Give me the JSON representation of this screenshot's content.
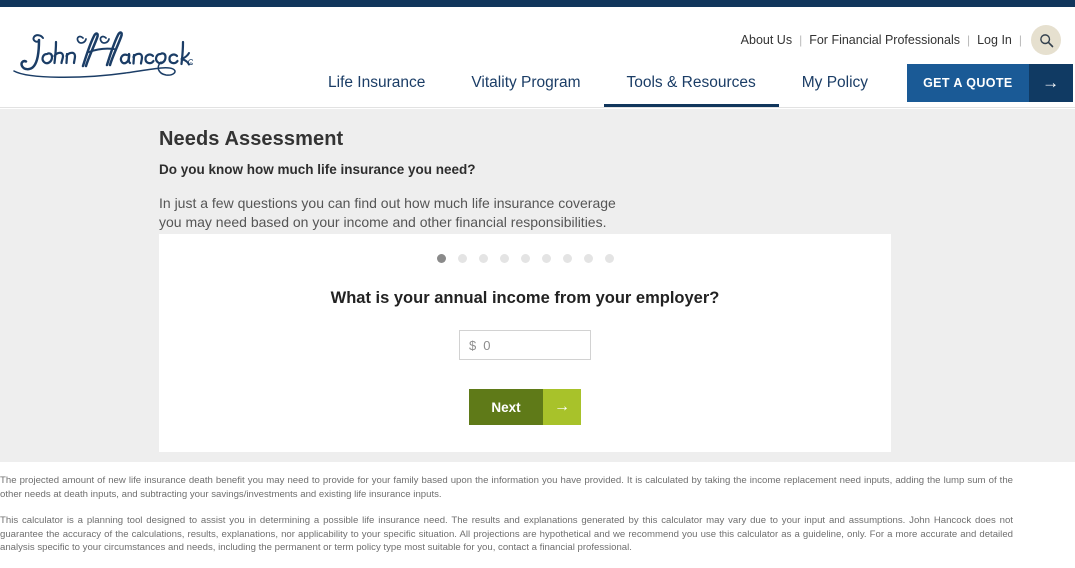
{
  "brand": {
    "logo_text": "John Hancock",
    "logo_color": "#1b3d66"
  },
  "header": {
    "utility_nav": [
      {
        "label": "About Us"
      },
      {
        "label": "For Financial Professionals"
      },
      {
        "label": "Log In"
      }
    ],
    "separator": "|",
    "search_icon": "search-icon",
    "main_nav": [
      {
        "label": "Life Insurance",
        "active": false
      },
      {
        "label": "Vitality Program",
        "active": false
      },
      {
        "label": "Tools & Resources",
        "active": true
      },
      {
        "label": "My Policy",
        "active": false
      }
    ],
    "quote_button": {
      "label": "GET A QUOTE",
      "arrow": "→",
      "body_color": "#1a5a96",
      "arrow_color": "#103a63"
    },
    "active_underline_color": "#11365c"
  },
  "main": {
    "page_title": "Needs Assessment",
    "subtitle": "Do you know how much life insurance you need?",
    "intro": "In just a few questions you can find out how much life insurance coverage you may need based on your income and other financial responsibilities."
  },
  "card": {
    "progress": {
      "total_steps": 9,
      "current_step": 1
    },
    "question": "What is your annual income from your employer?",
    "input": {
      "currency_symbol": "$",
      "value": "",
      "placeholder": "0"
    },
    "next_button": {
      "label": "Next",
      "arrow": "→",
      "body_color": "#5f7a18",
      "arrow_color": "#a8c22a"
    }
  },
  "disclaimer": {
    "paragraphs": [
      "The projected amount of new life insurance death benefit you may need to provide for your family based upon the information you have provided. It is calculated by taking the income replacement need inputs, adding the lump sum of the other needs at death inputs, and subtracting your savings/investments and existing life insurance inputs.",
      "This calculator is a planning tool designed to assist you in determining a possible life insurance need. The results and explanations generated by this calculator may vary due to your input and assumptions. John Hancock does not guarantee the accuracy of the calculations, results, explanations, nor applicability to your specific situation. All projections are hypothetical and we recommend you use this calculator as a guideline, only. For a more accurate and detailed analysis specific to your circumstances and needs, including the permanent or term policy type most suitable for you, contact a financial professional."
    ]
  }
}
